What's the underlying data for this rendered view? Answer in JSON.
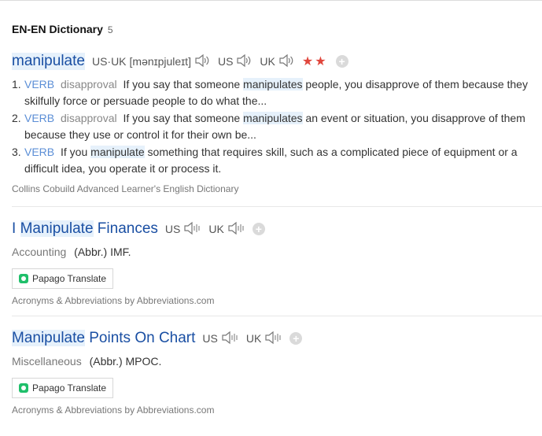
{
  "header": {
    "title": "EN-EN Dictionary",
    "count": "5"
  },
  "entry1": {
    "headword": "manipulate",
    "pron_label": "US·UK",
    "ipa": "[mənɪpjuleɪt]",
    "us": "US",
    "uk": "UK",
    "stars": "★★",
    "senses": [
      {
        "num": "1.",
        "pos": "VERB",
        "label": "disapproval",
        "pre": "If you say that someone ",
        "hl": "manipulates",
        "post": " people, you disapprove of them because they skilfully force or persuade people to do what the..."
      },
      {
        "num": "2.",
        "pos": "VERB",
        "label": "disapproval",
        "pre": "If you say that someone ",
        "hl": "manipulates",
        "post": " an event or situation, you disapprove of them because they use or control it for their own be..."
      },
      {
        "num": "3.",
        "pos": "VERB",
        "pre": "If you ",
        "hl": "manipulate",
        "post": " something that requires skill, such as a complicated piece of equipment or a difficult idea, you operate it or process it."
      }
    ],
    "source": "Collins Cobuild Advanced Learner's English Dictionary"
  },
  "entry2": {
    "pre": "I ",
    "hl": "Manipulate",
    "post": " Finances",
    "us": "US",
    "uk": "UK",
    "field": "Accounting",
    "abbr": "(Abbr.) IMF.",
    "papago": "Papago Translate",
    "source": "Acronyms & Abbreviations by Abbreviations.com"
  },
  "entry3": {
    "hl": "Manipulate",
    "post": " Points On Chart",
    "us": "US",
    "uk": "UK",
    "field": "Miscellaneous",
    "abbr": "(Abbr.) MPOC.",
    "papago": "Papago Translate",
    "source": "Acronyms & Abbreviations by Abbreviations.com"
  }
}
